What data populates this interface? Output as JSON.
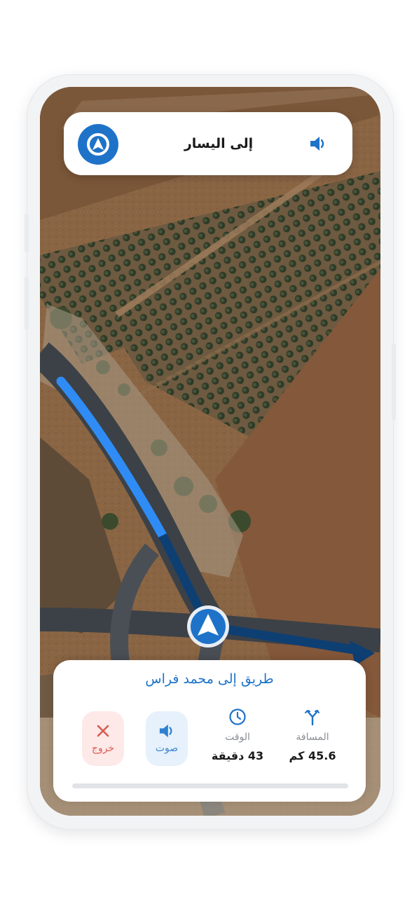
{
  "instruction": {
    "text": "إلى اليسار",
    "turn_icon": "navigation-turn-icon",
    "sound_icon": "speaker-icon"
  },
  "route": {
    "title": "طريق إلى محمد فراس"
  },
  "stats": {
    "distance_label": "المسافة",
    "distance_value": "45.6 كم",
    "distance_icon": "route-fork-icon",
    "time_label": "الوقت",
    "time_value": "43 دقيقة",
    "time_icon": "clock-icon"
  },
  "actions": {
    "sound_label": "صوت",
    "sound_icon": "speaker-icon",
    "exit_label": "خروج",
    "exit_icon": "close-icon"
  },
  "colors": {
    "accent": "#1e73c9",
    "route_active": "#2f8cf5",
    "route_upcoming": "#0e3f73",
    "exit": "#d95a52",
    "exit_bg": "#fde9e8",
    "sound_bg": "#e6f1fc"
  }
}
